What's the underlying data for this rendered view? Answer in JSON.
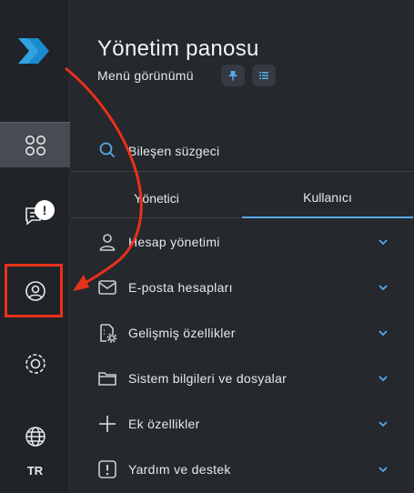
{
  "header": {
    "title": "Yönetim panosu",
    "subtitle": "Menü görünümü"
  },
  "rail": {
    "notification_count": "!",
    "language": "TR"
  },
  "search": {
    "label": "Bileşen süzgeci"
  },
  "tabs": [
    {
      "label": "Yönetici",
      "active": false
    },
    {
      "label": "Kullanıcı",
      "active": true
    }
  ],
  "sections": [
    {
      "label": "Hesap yönetimi",
      "icon": "person-icon"
    },
    {
      "label": "E-posta hesapları",
      "icon": "mail-icon"
    },
    {
      "label": "Gelişmiş özellikler",
      "icon": "file-settings-icon"
    },
    {
      "label": "Sistem bilgileri ve dosyalar",
      "icon": "folder-icon"
    },
    {
      "label": "Ek özellikler",
      "icon": "plus-icon"
    },
    {
      "label": "Yardım ve destek",
      "icon": "help-icon"
    }
  ],
  "colors": {
    "background": "#25282d",
    "rail": "#202328",
    "accent": "#5aa9e6",
    "annotation": "#e8311a"
  }
}
